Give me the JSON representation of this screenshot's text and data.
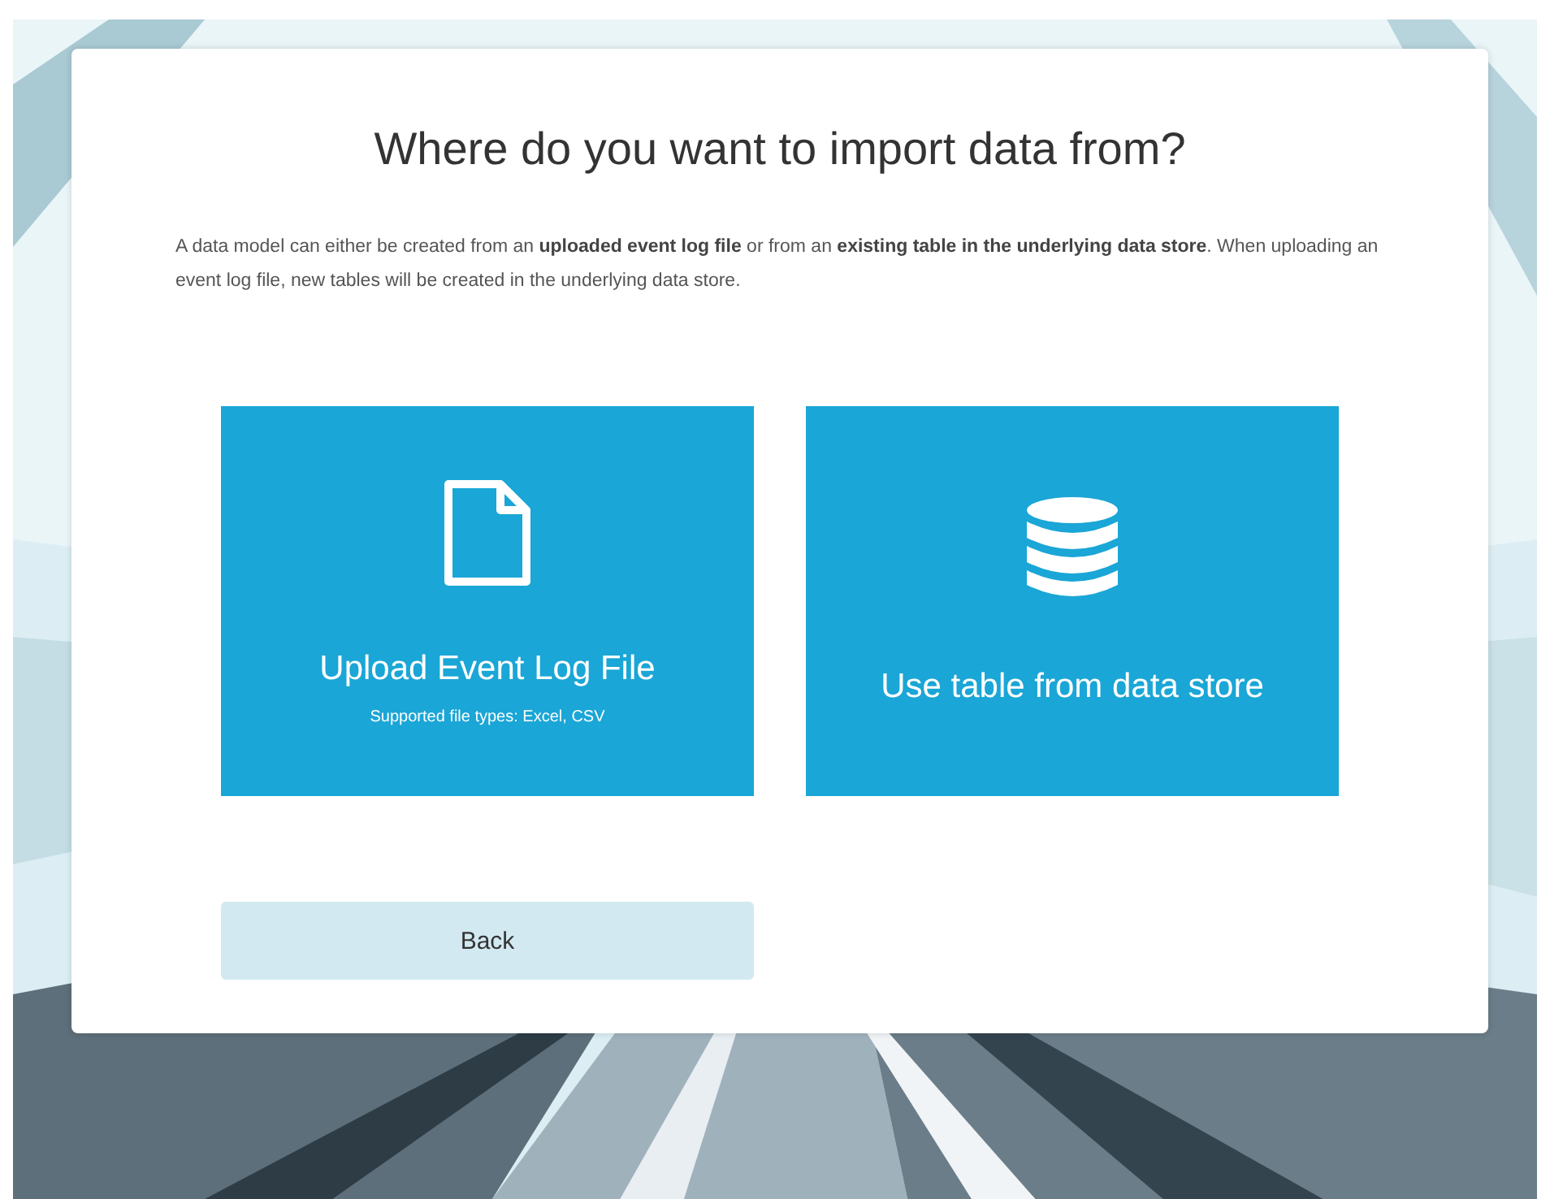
{
  "dialog": {
    "title": "Where do you want to import data from?",
    "description": "A data model can either be created from an **uploaded event log file** or from an **existing table in the underlying data store**. When uploading an event log file, new tables will be created in the underlying data store.",
    "options": [
      {
        "kind": "file",
        "label": "Upload Event Log File",
        "note": "Supported file types: Excel, CSV"
      },
      {
        "kind": "database",
        "label": "Use table from data store"
      }
    ],
    "back_button": "Back"
  }
}
